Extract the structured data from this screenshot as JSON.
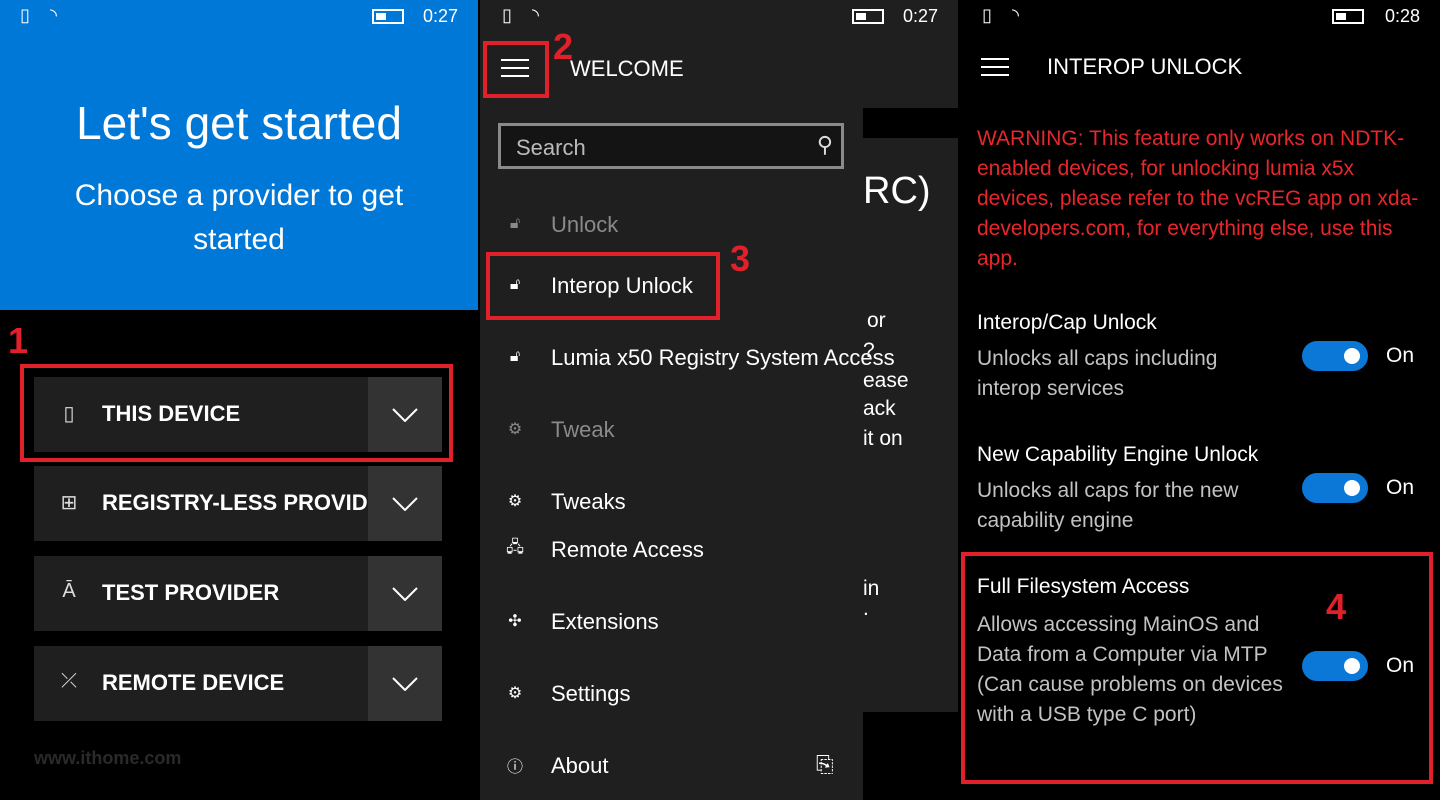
{
  "panel1": {
    "status": {
      "time": "0:27"
    },
    "hero": {
      "title": "Let's get started",
      "subtitle": "Choose a provider to get started"
    },
    "providers": [
      {
        "label": "THIS DEVICE",
        "icon": "phone-icon"
      },
      {
        "label": "REGISTRY-LESS PROVIDER",
        "icon": "registry-icon"
      },
      {
        "label": "TEST PROVIDER",
        "icon": "flask-icon"
      },
      {
        "label": "REMOTE DEVICE",
        "icon": "remote-icon"
      }
    ],
    "annotation": "1",
    "watermark": "www.ithome.com"
  },
  "panel2": {
    "status": {
      "time": "0:27"
    },
    "header": {
      "title": "WELCOME"
    },
    "annotation_menu": "2",
    "annotation_item": "3",
    "search": {
      "placeholder": "Search"
    },
    "nav": [
      {
        "label": "Unlock",
        "icon": "lock-icon",
        "type": "header"
      },
      {
        "label": "Interop Unlock",
        "icon": "lock-icon"
      },
      {
        "label": "Lumia x50 Registry System Access",
        "icon": "lock-icon"
      },
      {
        "label": "Tweak",
        "icon": "gear-icon",
        "type": "header"
      },
      {
        "label": "Tweaks",
        "icon": "gear-icon"
      },
      {
        "label": "Remote Access",
        "icon": "network-icon"
      },
      {
        "label": "Extensions",
        "icon": "puzzle-icon"
      },
      {
        "label": "Settings",
        "icon": "gear-icon"
      },
      {
        "label": "About",
        "icon": "info-icon"
      }
    ],
    "background_fragments": [
      "RC)",
      "or",
      "?",
      "ease",
      "ack",
      "it on",
      "in",
      "."
    ]
  },
  "panel3": {
    "status": {
      "time": "0:28"
    },
    "header": {
      "title": "INTEROP UNLOCK"
    },
    "warning": "WARNING: This feature only works on NDTK-enabled devices, for unlocking lumia x5x devices, please refer to the vcREG app on xda-developers.com, for everything else, use this app.",
    "warning_color": "#e8262c",
    "accent_color": "#0b78d7",
    "settings": [
      {
        "title": "Interop/Cap Unlock",
        "description": "Unlocks all caps including interop services",
        "state": "On",
        "enabled": true
      },
      {
        "title": "New Capability Engine Unlock",
        "description": "Unlocks all caps for the new capability engine",
        "state": "On",
        "enabled": true
      },
      {
        "title": "Full Filesystem Access",
        "description": "Allows accessing MainOS and Data from a Computer via MTP (Can cause problems on devices with a USB type C port)",
        "state": "On",
        "enabled": true
      }
    ],
    "annotation": "4"
  }
}
